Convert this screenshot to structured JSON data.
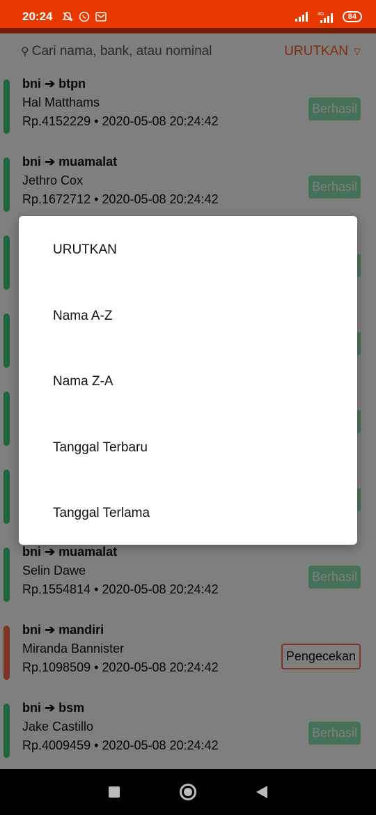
{
  "status_bar": {
    "time": "20:24",
    "battery": "84",
    "network_label": "4G"
  },
  "search": {
    "placeholder": "Cari nama, bank, atau nominal"
  },
  "sort_button": {
    "label": "URUTKAN",
    "arrow": "▽"
  },
  "transactions": [
    {
      "route": "bni ➔ btpn",
      "name": "Hal Matthams",
      "amount": "Rp.4152229",
      "datetime": "2020-05-08 20:24:42",
      "status": "Berhasil",
      "status_color": "#3ecf7e"
    },
    {
      "route": "bni ➔ muamalat",
      "name": "Jethro Cox",
      "amount": "Rp.1672712",
      "datetime": "2020-05-08 20:24:42",
      "status": "Berhasil",
      "status_color": "#3ecf7e"
    },
    {
      "route": "",
      "name": "",
      "amount": "",
      "datetime": "",
      "status": "",
      "status_color": "#3ecf7e"
    },
    {
      "route": "",
      "name": "",
      "amount": "",
      "datetime": "",
      "status": "",
      "status_color": "#3ecf7e"
    },
    {
      "route": "",
      "name": "",
      "amount": "",
      "datetime": "",
      "status": "",
      "status_color": "#3ecf7e"
    },
    {
      "route": "",
      "name": "",
      "amount": "",
      "datetime": "",
      "status": "",
      "status_color": "#3ecf7e"
    },
    {
      "route": "bni ➔ muamalat",
      "name": "Selin Dawe",
      "amount": "Rp.1554814",
      "datetime": "2020-05-08 20:24:42",
      "status": "Berhasil",
      "status_color": "#3ecf7e"
    },
    {
      "route": "bni ➔ mandiri",
      "name": "Miranda Bannister",
      "amount": "Rp.1098509",
      "datetime": "2020-05-08 20:24:42",
      "status": "Pengecekan",
      "status_color": "#ff6b4a"
    },
    {
      "route": "bni ➔ bsm",
      "name": "Jake Castillo",
      "amount": "Rp.4009459",
      "datetime": "2020-05-08 20:24:42",
      "status": "Berhasil",
      "status_color": "#3ecf7e"
    }
  ],
  "meta_separator": "•",
  "sort_dialog": {
    "title": "URUTKAN",
    "options": [
      "Nama A-Z",
      "Nama Z-A",
      "Tanggal Terbaru",
      "Tanggal Terlama"
    ]
  },
  "colors": {
    "accent": "#ff5a1f",
    "status_bar": "#e83a00",
    "success": "#8de3b3",
    "checking": "#ff6b4a"
  }
}
